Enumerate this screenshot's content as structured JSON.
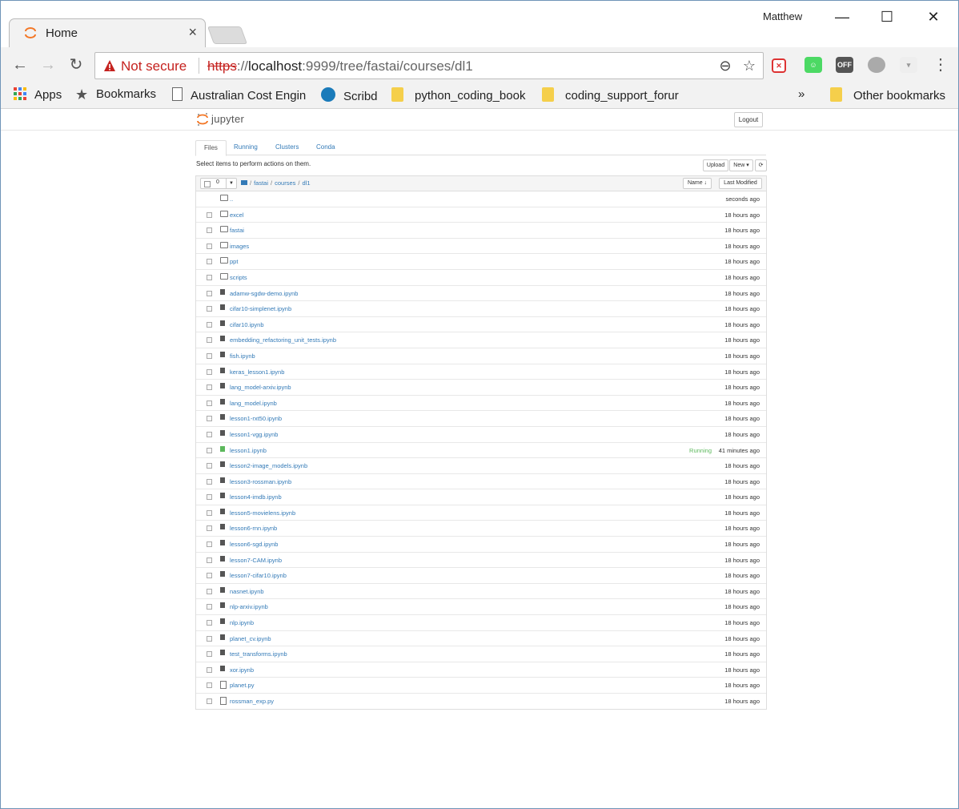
{
  "browser": {
    "tab_title": "Home",
    "tab_close": "×",
    "profile_name": "Matthew",
    "window_controls": {
      "minimize": "—",
      "maximize": "☐",
      "close": "✕"
    },
    "security_label": "Not secure",
    "url_scheme": "https",
    "url_sep": "://",
    "url_host": "localhost",
    "url_rest": ":9999/tree/fastai/courses/dl1",
    "accent_color": "#f37726",
    "warning_color": "#c5221f"
  },
  "bookmarks": {
    "items": [
      {
        "label": "Apps",
        "icon": "apps-grid-icon"
      },
      {
        "label": "Bookmarks",
        "icon": "star-icon"
      },
      {
        "label": "Australian Cost Engin",
        "icon": "page-icon"
      },
      {
        "label": "Scribd",
        "icon": "scribd-icon"
      },
      {
        "label": "python_coding_book",
        "icon": "folder-icon"
      },
      {
        "label": "coding_support_forur",
        "icon": "folder-icon"
      }
    ],
    "overflow": "»",
    "other": "Other bookmarks"
  },
  "jupyter": {
    "logo_text": "jupyter",
    "logout": "Logout",
    "tabs": [
      "Files",
      "Running",
      "Clusters",
      "Conda"
    ],
    "hint": "Select items to perform actions on them.",
    "upload": "Upload",
    "new": "New ▾",
    "refresh": "⟳",
    "selected_count": "0",
    "breadcrumb": [
      "fastai",
      "courses",
      "dl1"
    ],
    "sort_name": "Name ↓",
    "sort_modified": "Last Modified",
    "files": [
      {
        "name": "..",
        "kind": "folder",
        "time": "seconds ago",
        "status": ""
      },
      {
        "name": "excel",
        "kind": "folder",
        "time": "18 hours ago",
        "status": ""
      },
      {
        "name": "fastai",
        "kind": "folder",
        "time": "18 hours ago",
        "status": ""
      },
      {
        "name": "images",
        "kind": "folder",
        "time": "18 hours ago",
        "status": ""
      },
      {
        "name": "ppt",
        "kind": "folder",
        "time": "18 hours ago",
        "status": ""
      },
      {
        "name": "scripts",
        "kind": "folder",
        "time": "18 hours ago",
        "status": ""
      },
      {
        "name": "adamw-sgdw-demo.ipynb",
        "kind": "notebook",
        "time": "18 hours ago",
        "status": ""
      },
      {
        "name": "cifar10-simplenet.ipynb",
        "kind": "notebook",
        "time": "18 hours ago",
        "status": ""
      },
      {
        "name": "cifar10.ipynb",
        "kind": "notebook",
        "time": "18 hours ago",
        "status": ""
      },
      {
        "name": "embedding_refactoring_unit_tests.ipynb",
        "kind": "notebook",
        "time": "18 hours ago",
        "status": ""
      },
      {
        "name": "fish.ipynb",
        "kind": "notebook",
        "time": "18 hours ago",
        "status": ""
      },
      {
        "name": "keras_lesson1.ipynb",
        "kind": "notebook",
        "time": "18 hours ago",
        "status": ""
      },
      {
        "name": "lang_model-arxiv.ipynb",
        "kind": "notebook",
        "time": "18 hours ago",
        "status": ""
      },
      {
        "name": "lang_model.ipynb",
        "kind": "notebook",
        "time": "18 hours ago",
        "status": ""
      },
      {
        "name": "lesson1-rxt50.ipynb",
        "kind": "notebook",
        "time": "18 hours ago",
        "status": ""
      },
      {
        "name": "lesson1-vgg.ipynb",
        "kind": "notebook",
        "time": "18 hours ago",
        "status": ""
      },
      {
        "name": "lesson1.ipynb",
        "kind": "notebook-running",
        "time": "41 minutes ago",
        "status": "Running"
      },
      {
        "name": "lesson2-image_models.ipynb",
        "kind": "notebook",
        "time": "18 hours ago",
        "status": ""
      },
      {
        "name": "lesson3-rossman.ipynb",
        "kind": "notebook",
        "time": "18 hours ago",
        "status": ""
      },
      {
        "name": "lesson4-imdb.ipynb",
        "kind": "notebook",
        "time": "18 hours ago",
        "status": ""
      },
      {
        "name": "lesson5-movielens.ipynb",
        "kind": "notebook",
        "time": "18 hours ago",
        "status": ""
      },
      {
        "name": "lesson6-rnn.ipynb",
        "kind": "notebook",
        "time": "18 hours ago",
        "status": ""
      },
      {
        "name": "lesson6-sgd.ipynb",
        "kind": "notebook",
        "time": "18 hours ago",
        "status": ""
      },
      {
        "name": "lesson7-CAM.ipynb",
        "kind": "notebook",
        "time": "18 hours ago",
        "status": ""
      },
      {
        "name": "lesson7-cifar10.ipynb",
        "kind": "notebook",
        "time": "18 hours ago",
        "status": ""
      },
      {
        "name": "nasnet.ipynb",
        "kind": "notebook",
        "time": "18 hours ago",
        "status": ""
      },
      {
        "name": "nlp-arxiv.ipynb",
        "kind": "notebook",
        "time": "18 hours ago",
        "status": ""
      },
      {
        "name": "nlp.ipynb",
        "kind": "notebook",
        "time": "18 hours ago",
        "status": ""
      },
      {
        "name": "planet_cv.ipynb",
        "kind": "notebook",
        "time": "18 hours ago",
        "status": ""
      },
      {
        "name": "test_transforms.ipynb",
        "kind": "notebook",
        "time": "18 hours ago",
        "status": ""
      },
      {
        "name": "xor.ipynb",
        "kind": "notebook",
        "time": "18 hours ago",
        "status": ""
      },
      {
        "name": "planet.py",
        "kind": "file",
        "time": "18 hours ago",
        "status": ""
      },
      {
        "name": "rossman_exp.py",
        "kind": "file",
        "time": "18 hours ago",
        "status": ""
      }
    ]
  }
}
